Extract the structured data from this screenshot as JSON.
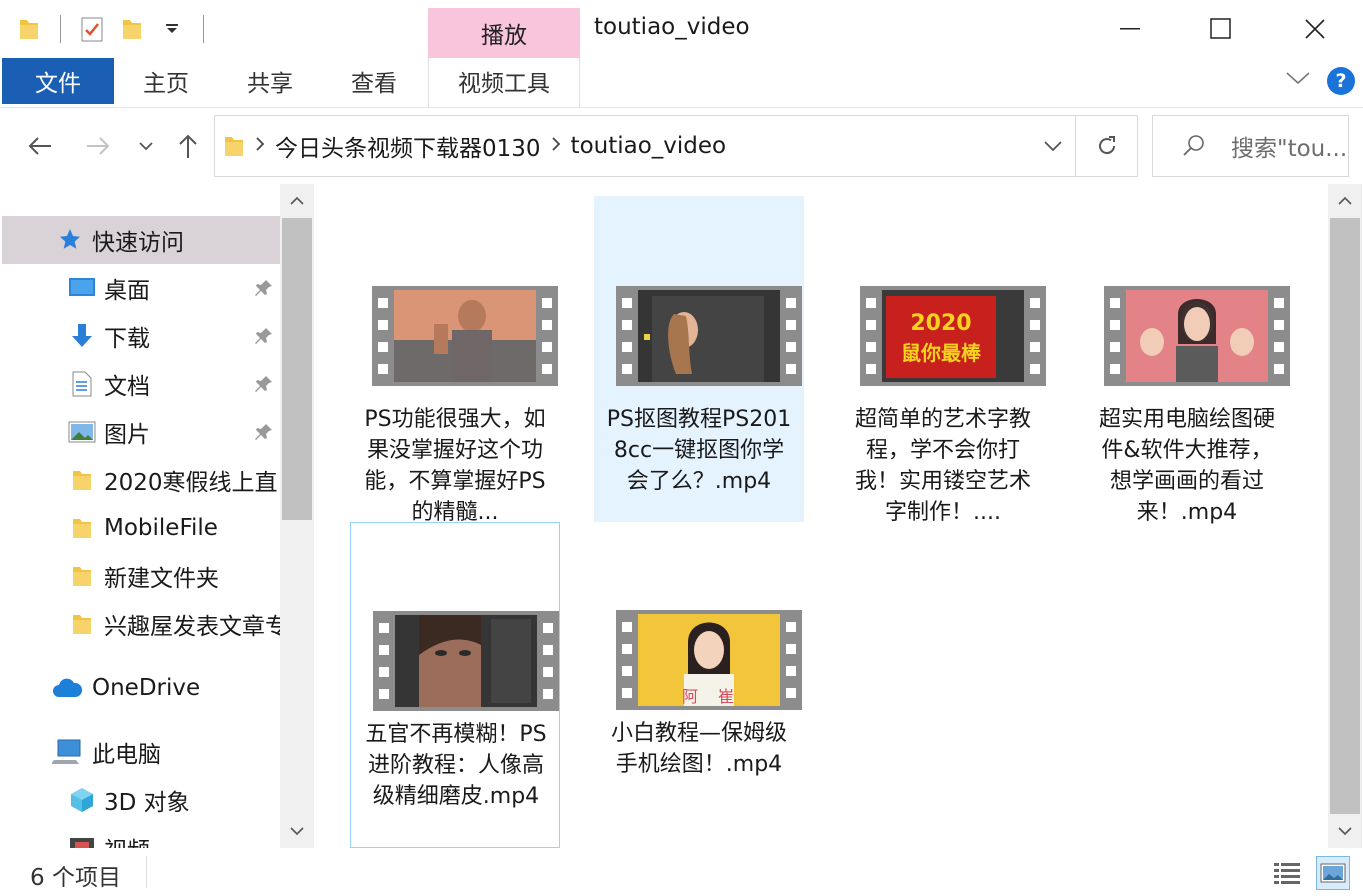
{
  "window": {
    "title": "toutiao_video",
    "context_tab_group": "播放"
  },
  "ribbon": {
    "tabs": [
      "文件",
      "主页",
      "共享",
      "查看",
      "视频工具"
    ],
    "help": "?"
  },
  "address": {
    "segments": [
      "今日头条视频下载器0130",
      "toutiao_video"
    ],
    "search_placeholder": "搜索\"tou..."
  },
  "nav": {
    "items": [
      {
        "label": "快速访问",
        "icon": "star-pin-icon",
        "indent": 1
      },
      {
        "label": "桌面",
        "icon": "desktop-icon",
        "indent": 2,
        "pinned": true
      },
      {
        "label": "下载",
        "icon": "download-icon",
        "indent": 2,
        "pinned": true
      },
      {
        "label": "文档",
        "icon": "document-icon",
        "indent": 2,
        "pinned": true
      },
      {
        "label": "图片",
        "icon": "pictures-icon",
        "indent": 2,
        "pinned": true
      },
      {
        "label": "2020寒假线上直",
        "icon": "folder-icon",
        "indent": 2
      },
      {
        "label": "MobileFile",
        "icon": "folder-icon",
        "indent": 2
      },
      {
        "label": "新建文件夹",
        "icon": "folder-icon",
        "indent": 2
      },
      {
        "label": "兴趣屋发表文章专",
        "icon": "folder-icon",
        "indent": 2
      },
      {
        "label": "OneDrive",
        "icon": "cloud-icon",
        "indent": 1
      },
      {
        "label": "此电脑",
        "icon": "computer-icon",
        "indent": 1
      },
      {
        "label": "3D 对象",
        "icon": "cube-icon",
        "indent": 2
      },
      {
        "label": "视频",
        "icon": "video-folder-icon",
        "indent": 2
      }
    ]
  },
  "files": [
    {
      "name": "PS功能很强大，如果没掌握好这个功能，不算掌握好PS的精髓...",
      "thumb_colors": [
        "#d98f6a",
        "#7a6a66"
      ]
    },
    {
      "name": "PS抠图教程PS2018cc一键抠图你学会了么？.mp4",
      "thumb_colors": [
        "#3a3a3a",
        "#c89a7a"
      ]
    },
    {
      "name": "超简单的艺术字教程，学不会你打我！实用镂空艺术字制作！....",
      "thumb_colors": [
        "#c8201c",
        "#f5d21e"
      ],
      "thumb_text": [
        "2020",
        "鼠你最棒"
      ]
    },
    {
      "name": "超实用电脑绘图硬件&软件大推荐，想学画画的看过来！.mp4",
      "thumb_colors": [
        "#e8848a",
        "#5a5a5a"
      ]
    },
    {
      "name": "五官不再模糊！PS进阶教程：人像高级精细磨皮.mp4",
      "thumb_colors": [
        "#3a3a3a",
        "#a07060"
      ]
    },
    {
      "name": "小白教程—保姆级手机绘图！.mp4",
      "thumb_colors": [
        "#f2c53a",
        "#f4f0ea"
      ],
      "thumb_text": [
        "阿",
        "崔"
      ]
    }
  ],
  "status": {
    "item_count": "6 个项目"
  }
}
